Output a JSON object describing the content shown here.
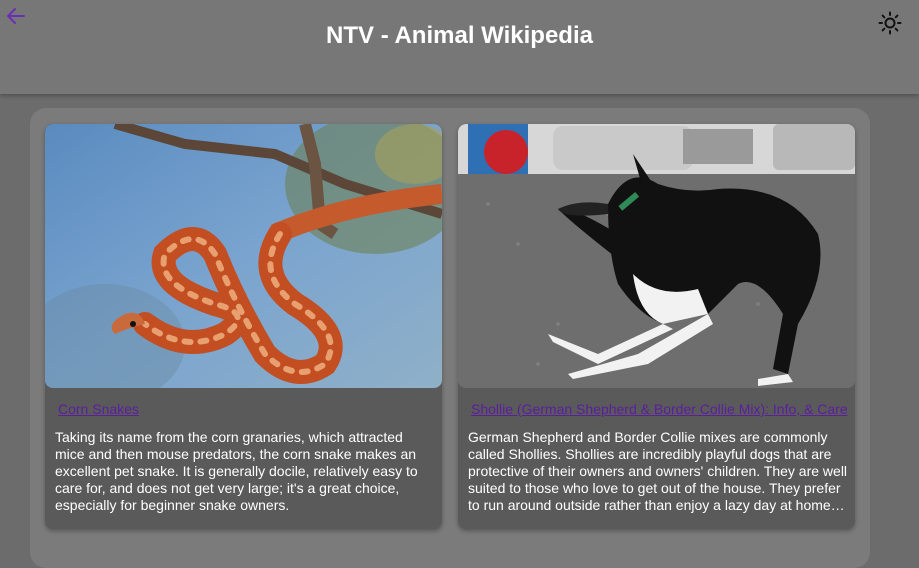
{
  "header": {
    "title": "NTV - Animal Wikipedia",
    "back_icon": "arrow-left-icon",
    "theme_icon": "sun-icon"
  },
  "colors": {
    "background": "#6c6c6c",
    "appbar": "#777777",
    "panel": "#7b7b7b",
    "card": "#5a5a5a",
    "link": "#5a1e9e",
    "accent": "#6a2fb5"
  },
  "cards": [
    {
      "link": "Corn Snakes",
      "description": "Taking its name from the corn granaries, which attracted mice and then mouse predators, the corn snake makes an excellent pet snake. It is generally docile, relatively easy to care for, and does not get very large; it's a great choice, especially for beginner snake owners."
    },
    {
      "link": "Shollie (German Shepherd & Border Collie Mix): Info, & Care",
      "description": "German Shepherd and Border Collie mixes are commonly called Shollies. Shollies are incredibly playful dogs that are protective of their owners and owners' children. They are well suited to those who love to get out of the house. They prefer to run around outside rather than enjoy a lazy day at home…"
    }
  ]
}
